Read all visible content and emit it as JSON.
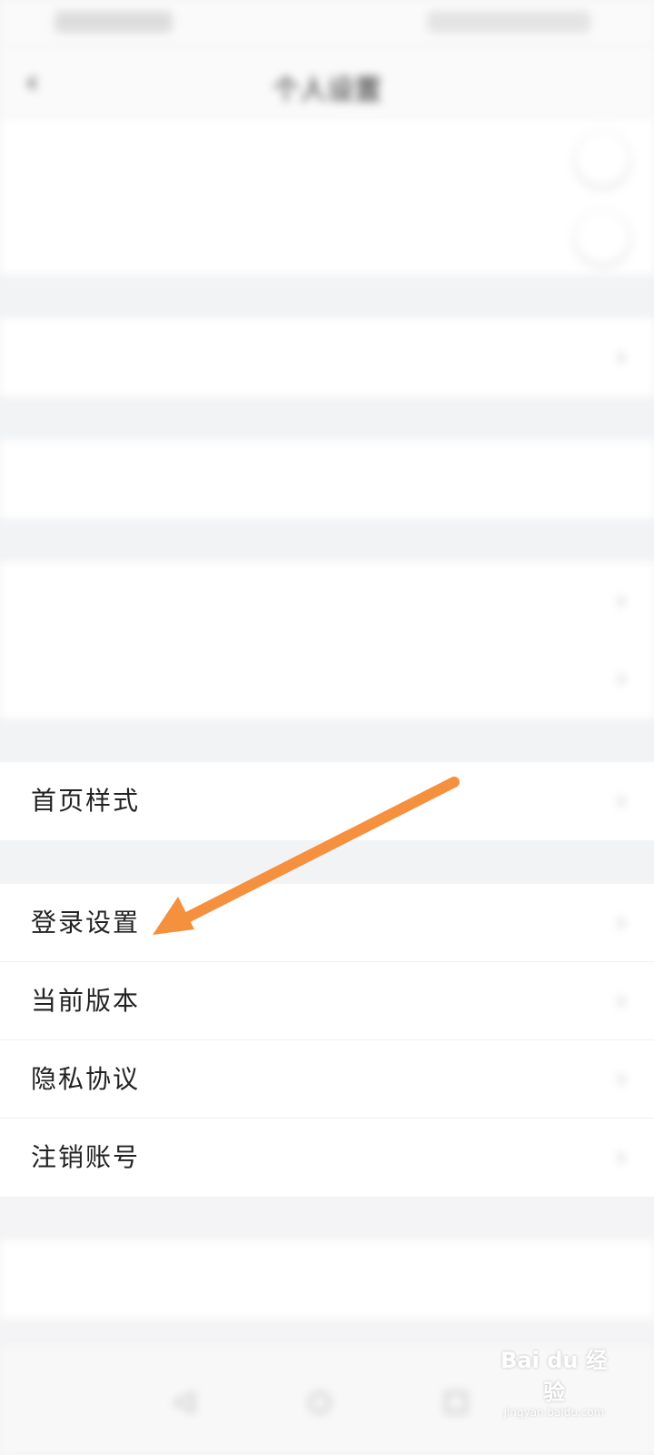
{
  "nav": {
    "title": "个人设置",
    "back_icon": "chevron-left-icon"
  },
  "settings_top": [
    {
      "label": "",
      "control": "toggle"
    },
    {
      "label": "",
      "control": "toggle"
    }
  ],
  "homepage_row": {
    "label": "首页样式",
    "value": ""
  },
  "menu": [
    {
      "label": "登录设置",
      "value": ""
    },
    {
      "label": "当前版本",
      "value": ""
    },
    {
      "label": "隐私协议",
      "value": ""
    },
    {
      "label": "注销账号",
      "value": ""
    }
  ],
  "annotation": {
    "arrow_color": "#f5903f"
  },
  "watermark": {
    "brand": "Bai du 经验",
    "url": "jingyan.baidu.com"
  },
  "colors": {
    "accent_red": "#e8453c",
    "background": "#f4f4f6"
  }
}
